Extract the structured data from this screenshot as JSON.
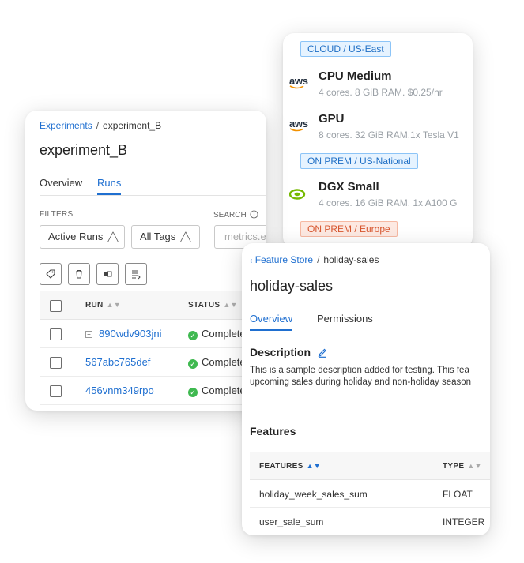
{
  "compute": {
    "regions": [
      {
        "label": "CLOUD / US-East"
      },
      {
        "label": "ON PREM / US-National"
      },
      {
        "label": "ON PREM / Europe"
      }
    ],
    "instances": [
      {
        "name": "CPU Medium",
        "spec": "4 cores. 8 GiB RAM. $0.25/hr",
        "provider_logo": "aws"
      },
      {
        "name": "GPU",
        "spec": "8 cores. 32 GiB RAM.1x Tesla V1",
        "provider_logo": "aws"
      },
      {
        "name": "DGX Small",
        "spec": "4 cores. 16 GiB RAM. 1x A100 G",
        "provider_logo": "nvidia-icon"
      }
    ]
  },
  "experiment": {
    "breadcrumb_root": "Experiments",
    "breadcrumb_sep": "/",
    "breadcrumb_current": "experiment_B",
    "title": "experiment_B",
    "tabs": [
      "Overview",
      "Runs"
    ],
    "active_tab": "Runs",
    "filters_label": "FILTERS",
    "search_label": "SEARCH",
    "runs_filter": "Active Runs",
    "tags_filter": "All Tags",
    "search_placeholder": "metrics.e",
    "toolbar_icons": [
      "tag-icon",
      "trash-icon",
      "columns-icon",
      "export-icon"
    ],
    "columns": {
      "run": "RUN",
      "status": "STATUS"
    },
    "rows": [
      {
        "run": "890wdv903jni",
        "status": "Complete"
      },
      {
        "run": "567abc765def",
        "status": "Complete"
      },
      {
        "run": "456vnm349rpo",
        "status": "Complete"
      }
    ]
  },
  "feature_store": {
    "breadcrumb_root": "Feature Store",
    "breadcrumb_sep": "/",
    "breadcrumb_current": "holiday-sales",
    "title": "holiday-sales",
    "tabs": [
      "Overview",
      "Permissions"
    ],
    "active_tab": "Overview",
    "description_label": "Description",
    "description_lines": [
      "This is a sample description added for testing. This fea",
      "upcoming sales during holiday and non-holiday season"
    ],
    "features_label": "Features",
    "columns": {
      "features": "FEATURES",
      "type": "TYPE"
    },
    "rows": [
      {
        "feature": "holiday_week_sales_sum",
        "type": "FLOAT"
      },
      {
        "feature": "user_sale_sum",
        "type": "INTEGER"
      }
    ]
  },
  "colors": {
    "link": "#1f6fd0",
    "success": "#3fb950",
    "cloud_tag": "#1f6fc5",
    "europe_tag": "#d7562f"
  }
}
